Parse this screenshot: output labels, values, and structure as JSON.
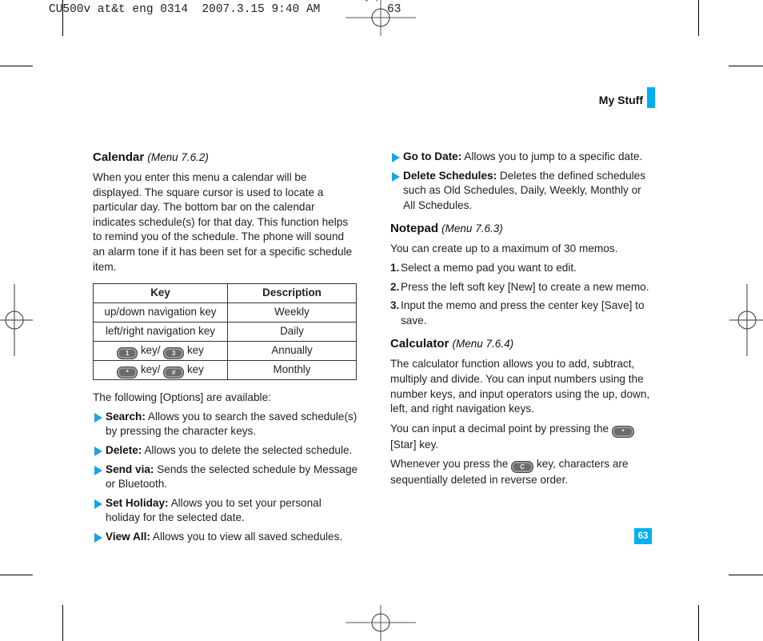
{
  "slug": {
    "text": "CU500v at&t eng 0314  2007.3.15 9:40 AM",
    "marks": "ˇ      ˋ",
    "page": "63"
  },
  "header": {
    "title": "My Stuff",
    "accent_color": "#00aeef"
  },
  "calendar": {
    "title": "Calendar",
    "menu": "(Menu 7.6.2)",
    "intro": "When you enter this menu a calendar will be displayed. The square cursor is used to locate a particular day. The bottom bar on the calendar indicates schedule(s) for that day. This function helps to remind you of the schedule. The phone will sound an alarm tone if it has been set for a specific schedule item.",
    "table": {
      "headers": [
        "Key",
        "Description"
      ],
      "rows": [
        {
          "key": "up/down navigation key",
          "description": "Weekly"
        },
        {
          "key": "left/right navigation key",
          "description": "Daily"
        },
        {
          "key_a": "1",
          "key_b": "3",
          "key_sep": " key/ ",
          "key_end": " key",
          "description": "Annually"
        },
        {
          "key_a": "*",
          "key_b": "#",
          "key_sep": " key/ ",
          "key_end": " key",
          "description": "Monthly"
        }
      ]
    },
    "options_intro": "The following [Options] are available:",
    "options": [
      {
        "label": "Search:",
        "text": " Allows you to search the saved schedule(s) by pressing the character keys."
      },
      {
        "label": "Delete:",
        "text": " Allows you to delete the selected schedule."
      },
      {
        "label": "Send via:",
        "text": " Sends the selected schedule by Message or Bluetooth."
      },
      {
        "label": "Set Holiday:",
        "text": " Allows you to set your personal holiday for the selected date."
      },
      {
        "label": "View All:",
        "text": " Allows you to view all saved schedules."
      },
      {
        "label": "Go to Date:",
        "text": " Allows you to jump to a specific date."
      },
      {
        "label": "Delete Schedules:",
        "text": " Deletes the defined schedules such as Old Schedules, Daily, Weekly, Monthly or All Schedules."
      }
    ]
  },
  "notepad": {
    "title": "Notepad",
    "menu": "(Menu 7.6.3)",
    "intro": "You can create up to a maximum of 30 memos.",
    "steps": [
      {
        "num": "1.",
        "text": "Select a memo pad you want to edit."
      },
      {
        "num": "2.",
        "text": "Press the left soft key [New] to create a new memo."
      },
      {
        "num": "3.",
        "text": "Input the memo and press the center key [Save] to save."
      }
    ]
  },
  "calculator": {
    "title": "Calculator",
    "menu": "(Menu 7.6.4)",
    "intro": "The calculator function allows you to add, subtract, multiply and divide. You can input numbers using the number keys, and input operators using the up, down, left, and right navigation keys.",
    "decimal_before": "You can input a decimal point by pressing the ",
    "decimal_key": "*",
    "decimal_after": " [Star] key.",
    "clear_before": "Whenever you press the ",
    "clear_key": "C",
    "clear_after": " key, characters are sequentially deleted in reverse order."
  },
  "footer": {
    "page_number": "63"
  }
}
